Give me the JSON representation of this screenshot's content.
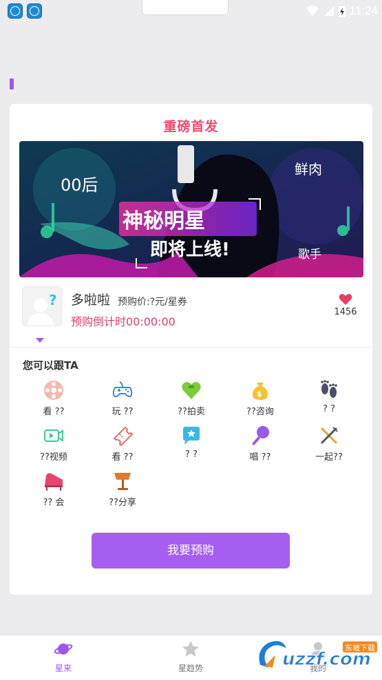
{
  "status_bar": {
    "time": "11:24"
  },
  "card": {
    "title": "重磅首发",
    "banner": {
      "main_text_1": "神秘明星",
      "main_text_2": "即将上线!",
      "tag_1": "00后",
      "tag_2": "鲜肉",
      "tag_3": "歌手"
    },
    "star": {
      "name": "多啦啦",
      "price": "预购价:?元/星券",
      "countdown": "预购倒计时00:00:00",
      "likes": "1456"
    },
    "section_title": "您可以跟TA",
    "options": [
      {
        "icon": "film-reel-icon",
        "label": "看 ??"
      },
      {
        "icon": "gamepad-icon",
        "label": "玩 ??"
      },
      {
        "icon": "heart-bag-icon",
        "label": "??拍卖"
      },
      {
        "icon": "money-bag-icon",
        "label": "??咨询"
      },
      {
        "icon": "footprints-icon",
        "label": "? ?"
      },
      {
        "icon": "video-camera-icon",
        "label": "??视频"
      },
      {
        "icon": "ticket-icon",
        "label": "看 ??"
      },
      {
        "icon": "chat-star-icon",
        "label": "? ?"
      },
      {
        "icon": "microphone-icon",
        "label": "唱 ??"
      },
      {
        "icon": "fork-knife-icon",
        "label": "一起??"
      },
      {
        "icon": "piano-icon",
        "label": "?? 会"
      },
      {
        "icon": "lamp-icon",
        "label": "??分享"
      }
    ],
    "buy_button": "我要预购"
  },
  "nav": {
    "items": [
      {
        "label": "星来",
        "icon": "planet-icon",
        "active": true
      },
      {
        "label": "星趋势",
        "icon": "star-icon",
        "active": false
      },
      {
        "label": "我的",
        "icon": "profile-icon",
        "active": false
      }
    ]
  },
  "watermark": {
    "brand": "uzzf.com",
    "sub": "东坡下载"
  },
  "colors": {
    "accent": "#a55ef0",
    "title_pink": "#f24a6b",
    "countdown": "#e23c6e"
  }
}
